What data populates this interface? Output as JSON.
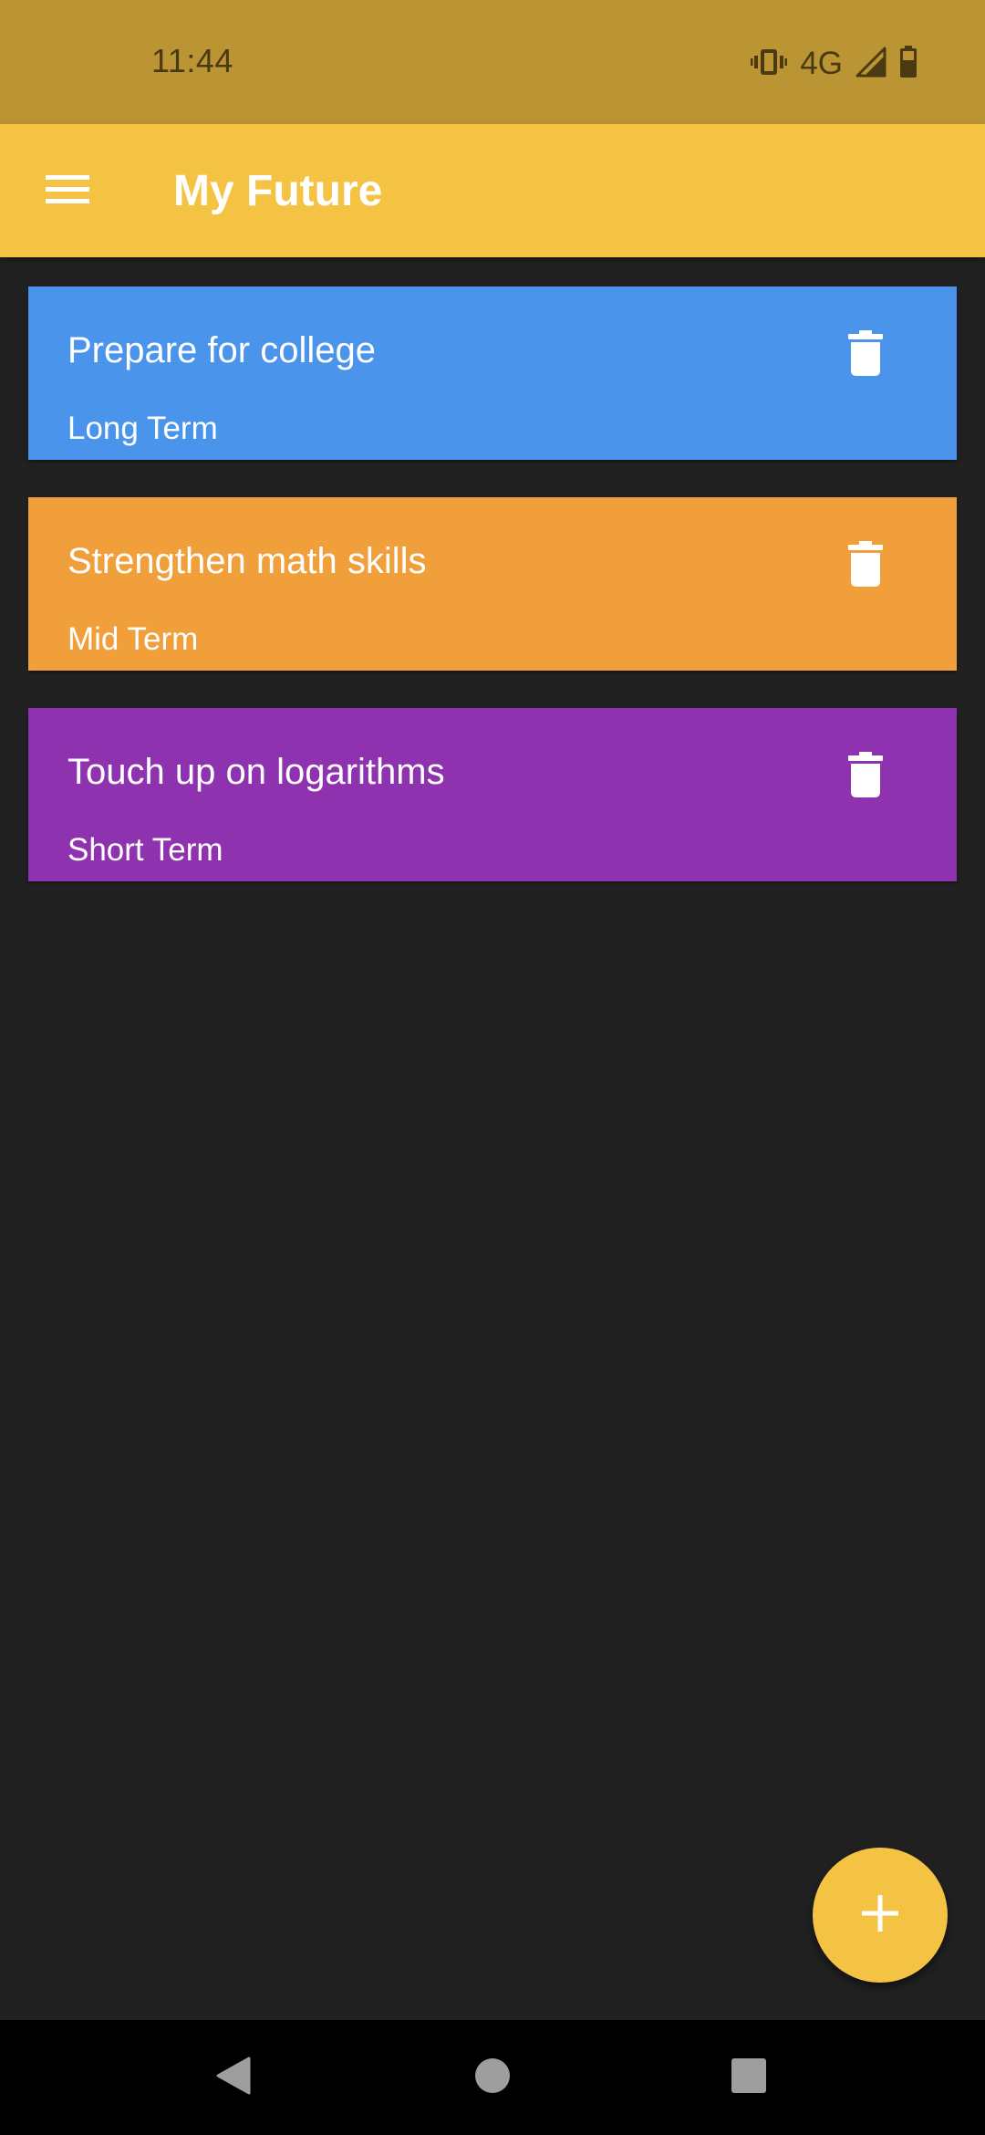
{
  "status_bar": {
    "time": "11:44",
    "network": "4G",
    "icons": [
      "vibrate-icon",
      "signal-icon",
      "battery-icon"
    ],
    "color": "#BB9434"
  },
  "app_bar": {
    "title": "My Future",
    "menu_icon": "hamburger-menu-icon",
    "color": "#F5C344"
  },
  "goals": [
    {
      "title": "Prepare for college",
      "term": "Long Term",
      "color": "#4A94EC",
      "delete_icon": "trash-icon"
    },
    {
      "title": "Strengthen math skills",
      "term": "Mid Term",
      "color": "#F09F3A",
      "delete_icon": "trash-icon"
    },
    {
      "title": "Touch up on logarithms",
      "term": "Short Term",
      "color": "#8E32AF",
      "delete_icon": "trash-icon"
    }
  ],
  "fab": {
    "icon": "plus-icon",
    "color": "#F5C344"
  },
  "nav_bar": {
    "icons": [
      "back-icon",
      "home-icon",
      "recents-icon"
    ]
  },
  "background_color": "#212121"
}
